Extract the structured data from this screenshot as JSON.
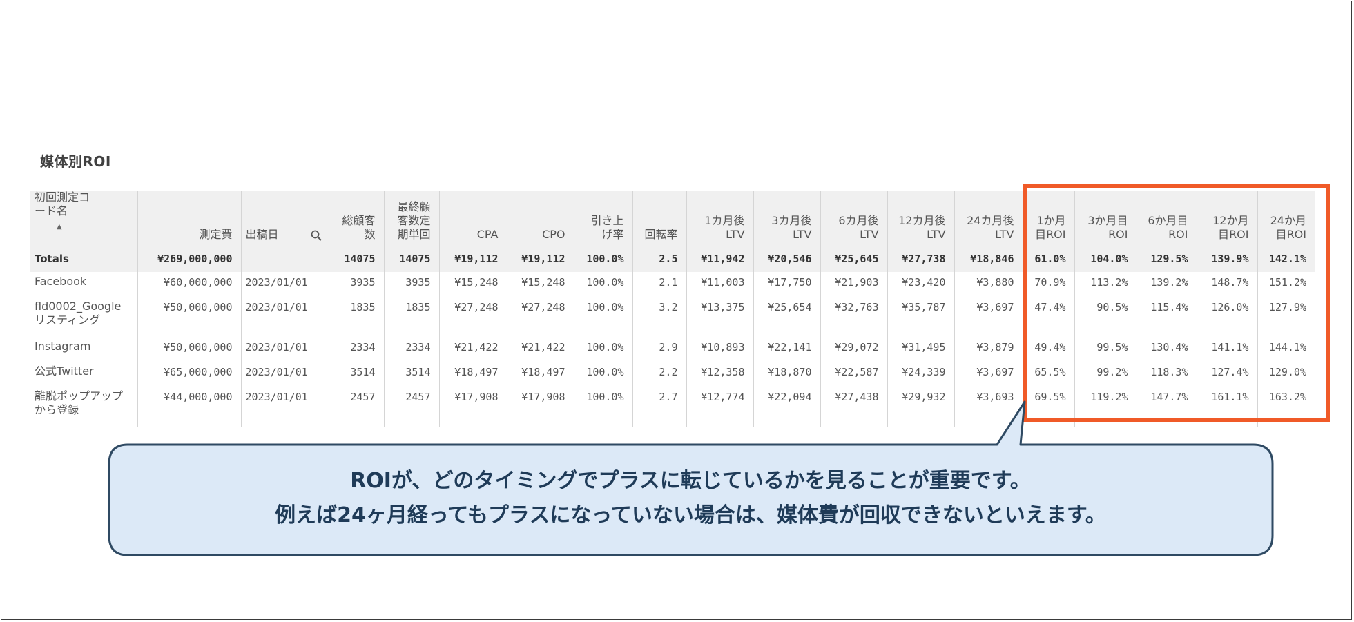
{
  "panel": {
    "title": "媒体別ROI"
  },
  "table": {
    "columns": [
      {
        "lines": [
          "初回測定コ",
          "ード名"
        ],
        "align": "left",
        "search": true,
        "sort": true
      },
      {
        "lines": [
          "測定費"
        ]
      },
      {
        "lines": [
          "出稿日"
        ],
        "align": "left",
        "search": true
      },
      {
        "lines": [
          "総顧客",
          "数"
        ]
      },
      {
        "lines": [
          "最終顧",
          "客数定",
          "期単回"
        ]
      },
      {
        "lines": [
          "CPA"
        ]
      },
      {
        "lines": [
          "CPO"
        ]
      },
      {
        "lines": [
          "引き上",
          "げ率"
        ]
      },
      {
        "lines": [
          "回転率"
        ]
      },
      {
        "lines": [
          "1カ月後",
          "LTV"
        ]
      },
      {
        "lines": [
          "3カ月後",
          "LTV"
        ]
      },
      {
        "lines": [
          "6カ月後",
          "LTV"
        ]
      },
      {
        "lines": [
          "12カ月後",
          "LTV"
        ]
      },
      {
        "lines": [
          "24カ月後",
          "LTV"
        ]
      },
      {
        "lines": [
          "1か月",
          "目ROI"
        ]
      },
      {
        "lines": [
          "3か月目",
          "ROI"
        ]
      },
      {
        "lines": [
          "6か月目",
          "ROI"
        ]
      },
      {
        "lines": [
          "12か月",
          "目ROI"
        ]
      },
      {
        "lines": [
          "24か月",
          "目ROI"
        ]
      }
    ],
    "totals": [
      "Totals",
      "¥269,000,000",
      "",
      "14075",
      "14075",
      "¥19,112",
      "¥19,112",
      "100.0%",
      "2.5",
      "¥11,942",
      "¥20,546",
      "¥25,645",
      "¥27,738",
      "¥18,846",
      "61.0%",
      "104.0%",
      "129.5%",
      "139.9%",
      "142.1%"
    ],
    "rows": [
      {
        "size": "short",
        "cells": [
          "Facebook",
          "¥60,000,000",
          "2023/01/01",
          "3935",
          "3935",
          "¥15,248",
          "¥15,248",
          "100.0%",
          "2.1",
          "¥11,003",
          "¥17,750",
          "¥21,903",
          "¥23,420",
          "¥3,880",
          "70.9%",
          "113.2%",
          "139.2%",
          "148.7%",
          "151.2%"
        ]
      },
      {
        "size": "tall",
        "cells": [
          "fld0002_Google リスティング",
          "¥50,000,000",
          "2023/01/01",
          "1835",
          "1835",
          "¥27,248",
          "¥27,248",
          "100.0%",
          "3.2",
          "¥13,375",
          "¥25,654",
          "¥32,763",
          "¥35,787",
          "¥3,697",
          "47.4%",
          "90.5%",
          "115.4%",
          "126.0%",
          "127.9%"
        ]
      },
      {
        "size": "short",
        "cells": [
          "Instagram",
          "¥50,000,000",
          "2023/01/01",
          "2334",
          "2334",
          "¥21,422",
          "¥21,422",
          "100.0%",
          "2.9",
          "¥10,893",
          "¥22,141",
          "¥29,072",
          "¥31,495",
          "¥3,879",
          "49.4%",
          "99.5%",
          "130.4%",
          "141.1%",
          "144.1%"
        ]
      },
      {
        "size": "short",
        "cells": [
          "公式Twitter",
          "¥65,000,000",
          "2023/01/01",
          "3514",
          "3514",
          "¥18,497",
          "¥18,497",
          "100.0%",
          "2.2",
          "¥12,358",
          "¥18,870",
          "¥22,587",
          "¥24,339",
          "¥3,697",
          "65.5%",
          "99.2%",
          "118.3%",
          "127.4%",
          "129.0%"
        ]
      },
      {
        "size": "tall",
        "cells": [
          "離脱ポップアップから登録",
          "¥44,000,000",
          "2023/01/01",
          "2457",
          "2457",
          "¥17,908",
          "¥17,908",
          "100.0%",
          "2.7",
          "¥12,774",
          "¥22,094",
          "¥27,438",
          "¥29,932",
          "¥3,693",
          "69.5%",
          "119.2%",
          "147.7%",
          "161.1%",
          "163.2%"
        ]
      }
    ]
  },
  "callout": {
    "line1": "ROIが、どのタイミングでプラスに転じているかを見ることが重要です。",
    "line2": "例えば24ヶ月経ってもプラスになっていない場合は、媒体費が回収できないといえます。"
  },
  "colors": {
    "highlight": "#f05a28",
    "callout_fill": "#dce9f7",
    "callout_border": "#2f4a63",
    "callout_text": "#1f3b58"
  }
}
